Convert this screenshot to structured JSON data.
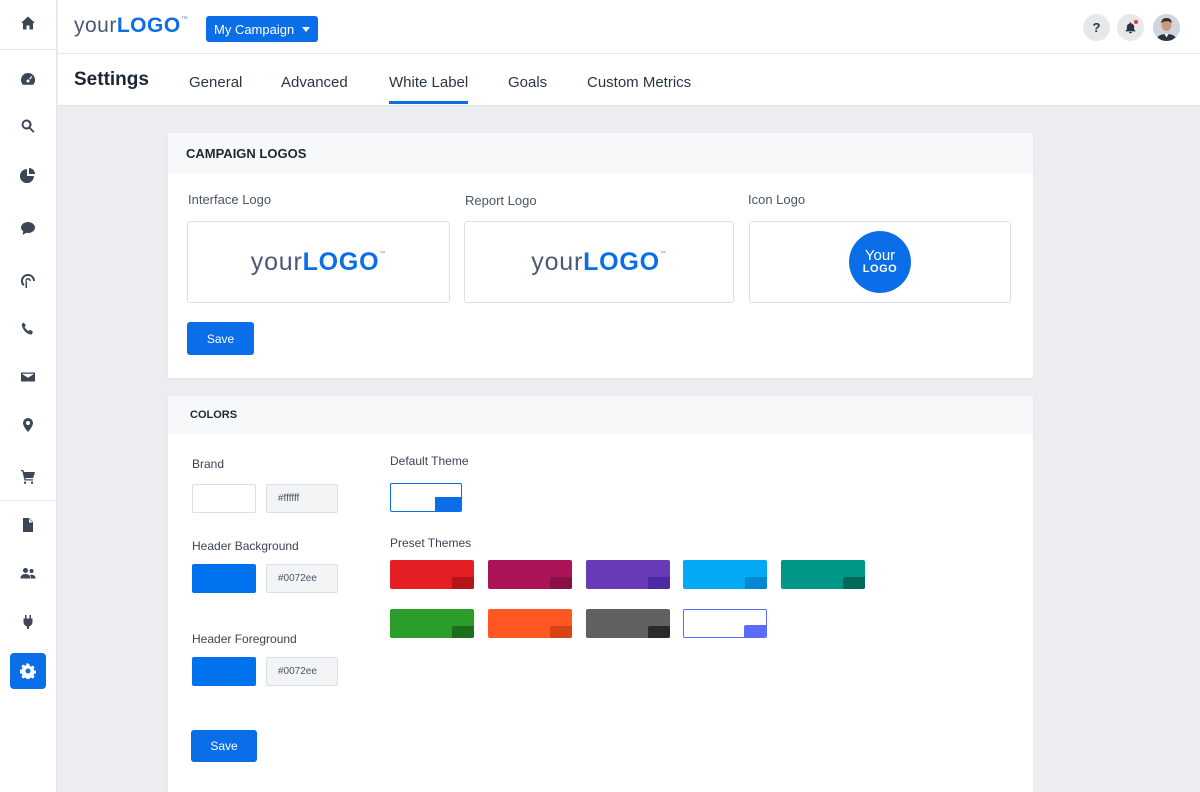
{
  "header": {
    "logo_your": "your",
    "logo_big": "LOGO",
    "logo_tm": "™",
    "campaign_label": "My Campaign",
    "help_label": "?"
  },
  "sidebar": {
    "items": [
      "home-icon",
      "dashboard-icon",
      "search-icon",
      "pie-chart-icon",
      "chat-icon",
      "signal-icon",
      "phone-icon",
      "mail-icon",
      "location-icon",
      "cart-icon",
      "document-icon",
      "users-icon",
      "plug-icon",
      "gear-icon"
    ],
    "active": "gear-icon"
  },
  "settings": {
    "title": "Settings",
    "tabs": [
      {
        "label": "General"
      },
      {
        "label": "Advanced"
      },
      {
        "label": "White Label",
        "active": true
      },
      {
        "label": "Goals"
      },
      {
        "label": "Custom Metrics"
      }
    ]
  },
  "logos": {
    "heading": "CAMPAIGN LOGOS",
    "interface_label": "Interface Logo",
    "report_label": "Report Logo",
    "icon_label": "Icon Logo",
    "icon_line1": "Your",
    "icon_line2": "LOGO",
    "save_label": "Save"
  },
  "colors": {
    "heading": "COLORS",
    "brand": {
      "label": "Brand",
      "value": "#ffffff"
    },
    "header_background": {
      "label": "Header Background",
      "value": "#0072ee"
    },
    "header_foreground": {
      "label": "Header Foreground",
      "value": "#0072ee"
    },
    "default_theme_label": "Default Theme",
    "preset_label": "Preset Themes",
    "presets": [
      {
        "main": "#e31e24",
        "accent": "#b3151a"
      },
      {
        "main": "#ad1457",
        "accent": "#8a0f44"
      },
      {
        "main": "#673ab7",
        "accent": "#4d29a6"
      },
      {
        "main": "#03a9f4",
        "accent": "#0288d1"
      },
      {
        "main": "#009688",
        "accent": "#00695c"
      },
      {
        "main": "#2a9d2a",
        "accent": "#1b6e1b"
      },
      {
        "main": "#ff5722",
        "accent": "#d84315"
      },
      {
        "main": "#616161",
        "accent": "#2a2a2a"
      },
      {
        "main": "#ffffff",
        "accent": "#5b6cf8",
        "outline": "#5b6cf8"
      }
    ],
    "save_label": "Save"
  }
}
